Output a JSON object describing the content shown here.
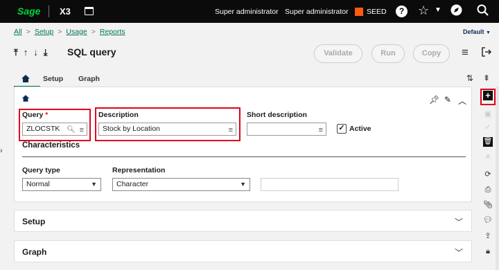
{
  "topbar": {
    "logo": "Sage",
    "product": "X3",
    "user1": "Super administrator",
    "user2": "Super administrator",
    "folder": "SEED",
    "help_icon": "?",
    "colors": {
      "bg": "#0b0b0b",
      "logo": "#00d639",
      "folder_swatch": "#ff5b0f"
    }
  },
  "breadcrumb": [
    "All",
    "Setup",
    "Usage",
    "Reports"
  ],
  "view_selector": "Default",
  "page": {
    "title": "SQL query"
  },
  "actions": {
    "validate": "Validate",
    "run": "Run",
    "copy": "Copy"
  },
  "tabs": [
    {
      "label": "Setup"
    },
    {
      "label": "Graph"
    }
  ],
  "form": {
    "query_label": "Query",
    "query_required_mark": "*",
    "query_value": "ZLOCSTK",
    "description_label": "Description",
    "description_value": "Stock by Location",
    "short_description_label": "Short description",
    "short_description_value": "",
    "active_label": "Active",
    "active_checked": true,
    "characteristics_title": "Characteristics",
    "query_type_label": "Query type",
    "query_type_value": "Normal",
    "representation_label": "Representation",
    "representation_value": "Character",
    "extra_value": ""
  },
  "sections": {
    "setup": "Setup",
    "graph": "Graph"
  },
  "accent_color": "#00755a",
  "highlight_color": "#e0001b"
}
